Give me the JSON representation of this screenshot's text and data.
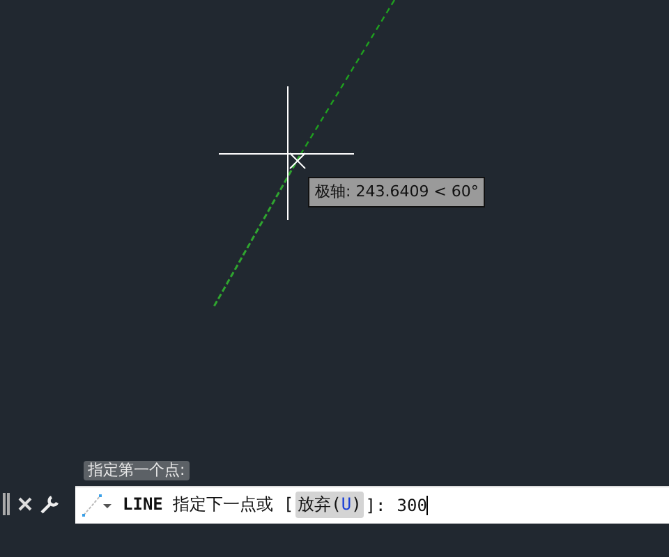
{
  "canvas": {
    "tooltip": "极轴: 243.6409 < 60°"
  },
  "prompt_history": "指定第一个点:",
  "command_line": {
    "prompt": "**LINE** 指定下一点或 [",
    "option": {
      "label": "放弃",
      "key_open": "(",
      "key": "U",
      "key_close": ")"
    },
    "prompt_end": "]:",
    "value": "300"
  }
}
